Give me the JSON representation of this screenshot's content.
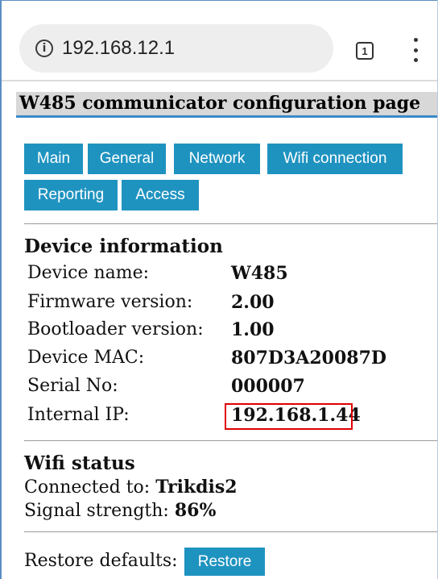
{
  "browser": {
    "url": "192.168.12.1",
    "tab_count": "1"
  },
  "page": {
    "title": "W485 communicator configuration page",
    "nav": [
      "Main",
      "General",
      "Network",
      "Wifi connection",
      "Reporting",
      "Access"
    ],
    "device_info": {
      "heading": "Device information",
      "rows": [
        {
          "label": "Device name:",
          "value": "W485"
        },
        {
          "label": "Firmware version:",
          "value": "2.00"
        },
        {
          "label": "Bootloader version:",
          "value": "1.00"
        },
        {
          "label": "Device MAC:",
          "value": "807D3A20087D"
        },
        {
          "label": "Serial No:",
          "value": "000007"
        },
        {
          "label": "Internal IP:",
          "value": "192.168.1.44"
        }
      ]
    },
    "wifi_status": {
      "heading": "Wifi status",
      "connected_label": "Connected to:",
      "connected_value": "Trikdis2",
      "signal_label": "Signal strength:",
      "signal_value": "86%"
    },
    "restore": {
      "label": "Restore defaults:",
      "button": "Restore"
    }
  },
  "colors": {
    "nav_button": "#1f93c0",
    "title_underline": "#3b8ac9",
    "highlight_box": "#e00000"
  }
}
